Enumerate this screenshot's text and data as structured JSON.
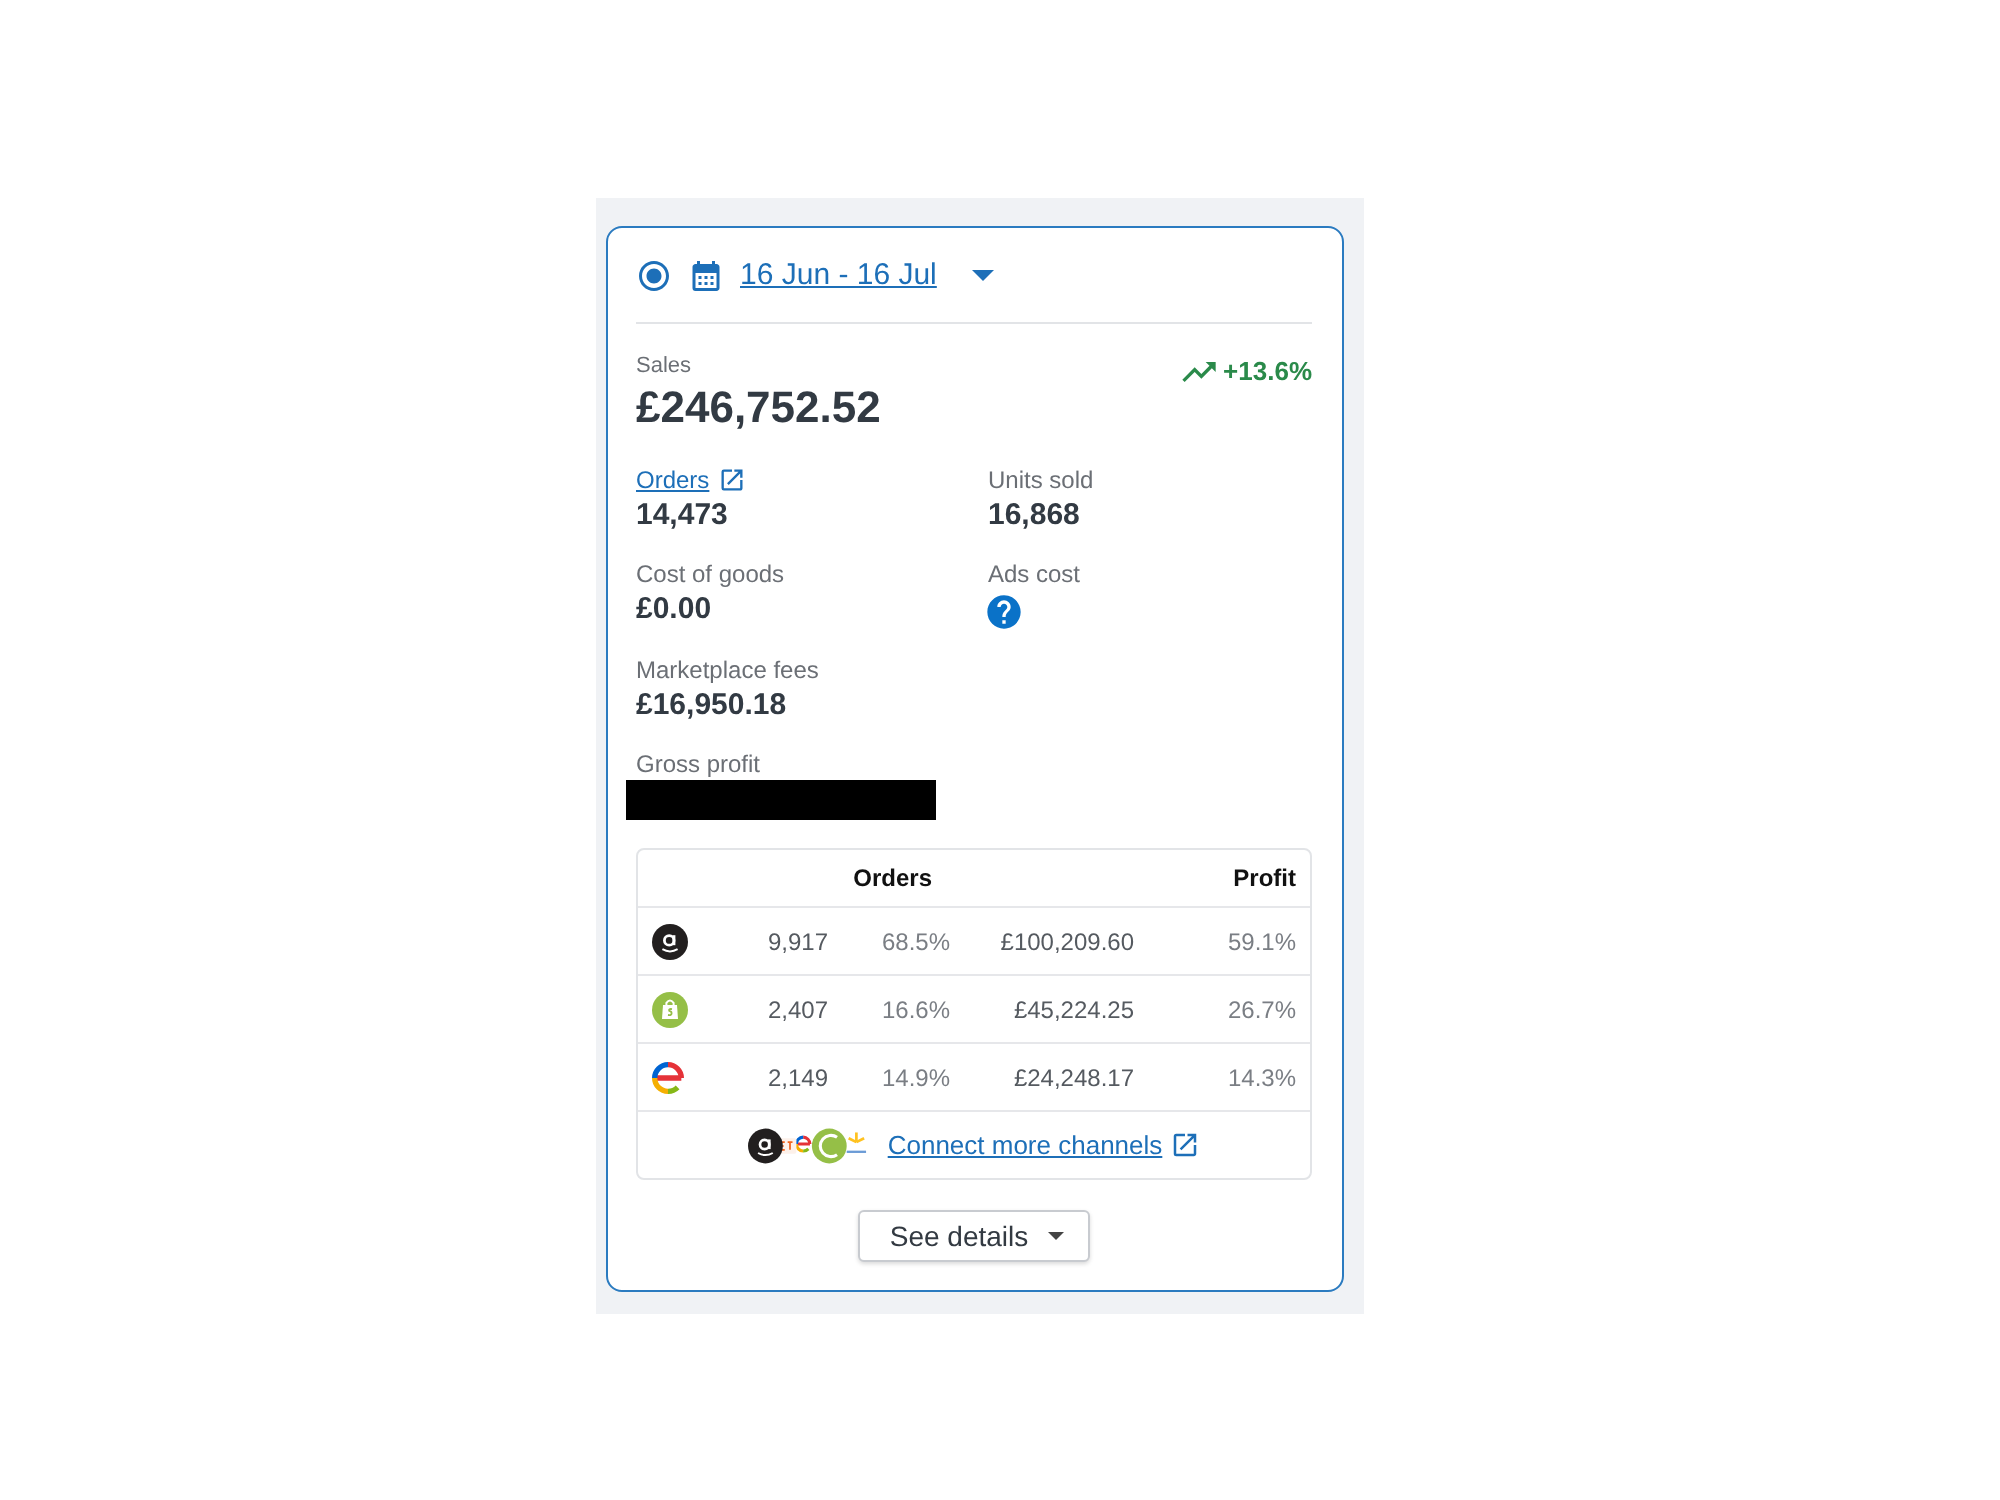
{
  "date_range": {
    "label": "16 Jun - 16 Jul",
    "selected": true
  },
  "sales": {
    "label": "Sales",
    "value": "£246,752.52",
    "change": "+13.6%",
    "change_positive": true
  },
  "metric_rows": [
    {
      "items": [
        {
          "kind": "link",
          "label": "Orders",
          "value": "14,473"
        },
        {
          "kind": "plain",
          "label": "Units sold",
          "value": "16,868"
        }
      ]
    },
    {
      "items": [
        {
          "kind": "plain",
          "label": "Cost of goods",
          "value": "£0.00"
        },
        {
          "kind": "help",
          "label": "Ads cost"
        }
      ]
    },
    {
      "items": [
        {
          "kind": "plain",
          "label": "Marketplace fees",
          "value": "£16,950.18"
        }
      ]
    },
    {
      "items": [
        {
          "kind": "redacted",
          "label": "Gross profit"
        }
      ]
    }
  ],
  "channels_table": {
    "columns": [
      {
        "label": "Orders"
      },
      {
        "label": "Profit"
      }
    ],
    "rows": [
      {
        "kind": "disc",
        "orders_count": "9,917",
        "orders_share": "68.5%",
        "column_4": "£100,209.60",
        "profit": "59.1%"
      },
      {
        "kind": "bag",
        "orders_count": "2,407",
        "orders_share": "16.6%",
        "column_4": "£45,224.25",
        "profit": "26.7%"
      },
      {
        "kind": "ring",
        "orders_count": "2,149",
        "orders_share": "14.9%",
        "column_4": "£24,248.17",
        "profit": "14.3%"
      }
    ],
    "footer_link": "Connect more channels"
  },
  "details_button": {
    "label": "See details"
  }
}
